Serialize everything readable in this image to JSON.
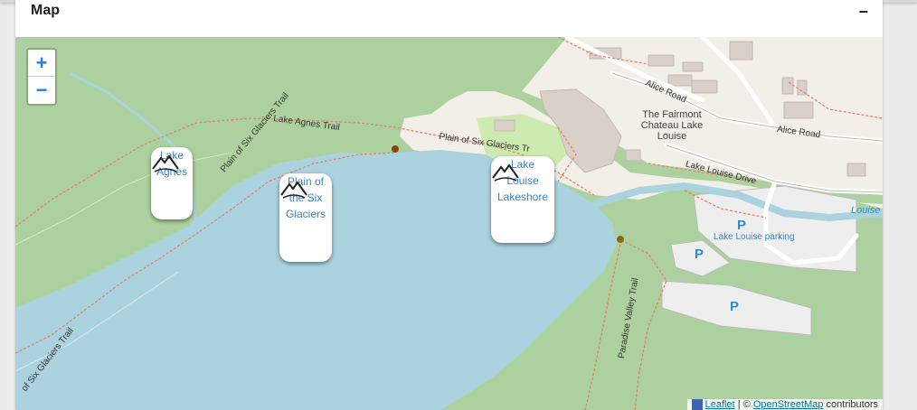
{
  "panel": {
    "title": "Map",
    "collapse_symbol": "−"
  },
  "zoom": {
    "in": "+",
    "out": "−"
  },
  "markers": [
    {
      "label": "Lake Agnes",
      "icon": "mountain-icon"
    },
    {
      "label": "Plain of the Six Glaciers",
      "icon": "mountain-icon"
    },
    {
      "label": "Lake Louise Lakeshore",
      "icon": "mountain-icon"
    }
  ],
  "map_labels": {
    "lake_agnes_trail": "Lake Agnes Trail",
    "plain_trail_1": "Plain of Six Glaciers Trail",
    "plain_trail_2": "Plain of Six Glaciers Tr",
    "plain_trail_3": "of Six Glaciers Trail",
    "paradise_valley_trail": "Paradise Valley Trail",
    "alice_road_1": "Alice Road",
    "alice_road_2": "Alice Road",
    "lake_louise_drive": "Lake Louise Drive",
    "chateau": "The Fairmont Chateau Lake Louise",
    "parking_label": "Lake Louise parking",
    "lake_edge": "Louise"
  },
  "parking_symbol": "P",
  "attribution": {
    "leaflet": "Leaflet",
    "separator": " | © ",
    "osm": "OpenStreetMap",
    "suffix": " contributors"
  },
  "colors": {
    "water": "#aad3df",
    "forest": "#add19e",
    "land": "#f2efe9",
    "trail": "#fa8072",
    "link": "#3b82c4"
  }
}
